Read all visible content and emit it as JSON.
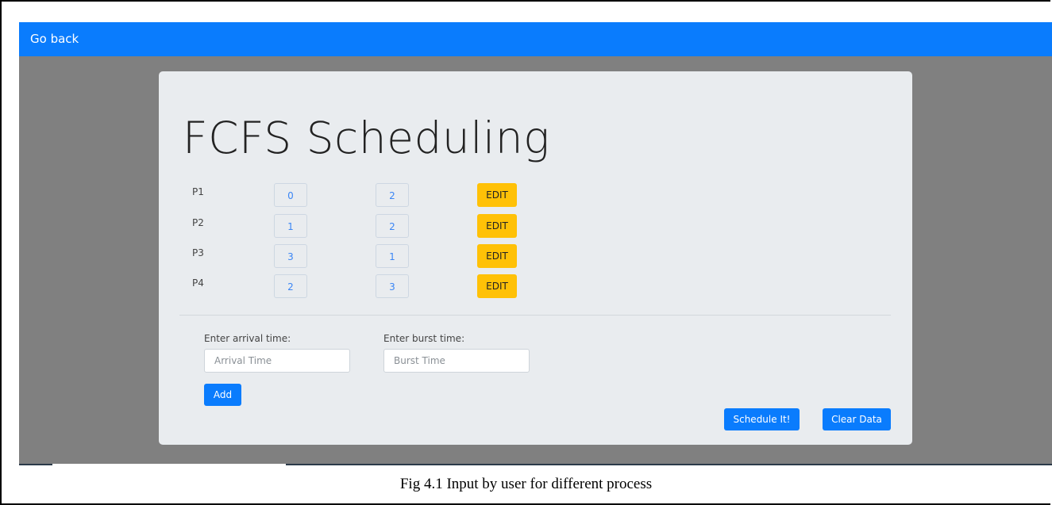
{
  "navbar": {
    "back_label": "Go back"
  },
  "card": {
    "title": "FCFS Scheduling"
  },
  "processes": [
    {
      "name": "P1",
      "arrival": "0",
      "burst": "2",
      "edit_label": "EDIT"
    },
    {
      "name": "P2",
      "arrival": "1",
      "burst": "2",
      "edit_label": "EDIT"
    },
    {
      "name": "P3",
      "arrival": "3",
      "burst": "1",
      "edit_label": "EDIT"
    },
    {
      "name": "P4",
      "arrival": "2",
      "burst": "3",
      "edit_label": "EDIT"
    }
  ],
  "form": {
    "arrival_label": "Enter arrival time:",
    "arrival_placeholder": "Arrival Time",
    "burst_label": "Enter burst time:",
    "burst_placeholder": "Burst Time",
    "add_label": "Add"
  },
  "actions": {
    "schedule_label": "Schedule It!",
    "clear_label": "Clear Data"
  },
  "caption": "Fig 4.1 Input by user for different process",
  "colors": {
    "primary": "#0a7cfd",
    "warning": "#ffc107",
    "backdrop": "#808080",
    "card": "#e9ecef"
  }
}
